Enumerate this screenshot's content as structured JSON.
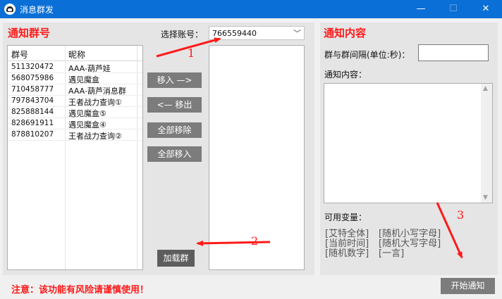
{
  "window": {
    "title": "消息群发",
    "minimize": "—",
    "maximize": "☐",
    "close": "✕"
  },
  "left": {
    "title": "通知群号",
    "columns": [
      "群号",
      "昵称"
    ],
    "rows": [
      {
        "id": "511320472",
        "name": "AAA-葫芦娃"
      },
      {
        "id": "568075986",
        "name": "遇见魔盒"
      },
      {
        "id": "710458777",
        "name": "AAA-葫芦消息群"
      },
      {
        "id": "797843704",
        "name": "王者战力查询①"
      },
      {
        "id": "825888144",
        "name": "遇见魔盒⑤"
      },
      {
        "id": "828691911",
        "name": "遇见魔盒④"
      },
      {
        "id": "878810207",
        "name": "王者战力查询②"
      }
    ],
    "account_label": "选择账号：",
    "account_value": "766559440",
    "btn_move_in": "移入 —>",
    "btn_move_out": "<— 移出",
    "btn_remove_all": "全部移除",
    "btn_add_all": "全部移入",
    "btn_load": "加载群"
  },
  "right": {
    "title": "通知内容",
    "interval_label": "群与群间隔(单位:秒)：",
    "interval_value": "",
    "content_label": "通知内容：",
    "content_value": "",
    "vars_label": "可用变量：",
    "vars": [
      [
        "[艾特全体]",
        "[随机小写字母]"
      ],
      [
        "[当前时间]",
        "[随机大写字母]"
      ],
      [
        "[随机数字]",
        "[一言]"
      ]
    ],
    "btn_start": "开始通知"
  },
  "warning": "注意：该功能有风险请谨慎使用！",
  "annotations": {
    "n1": "1",
    "n2": "2",
    "n3": "3",
    "color": "#ff1a1a"
  }
}
